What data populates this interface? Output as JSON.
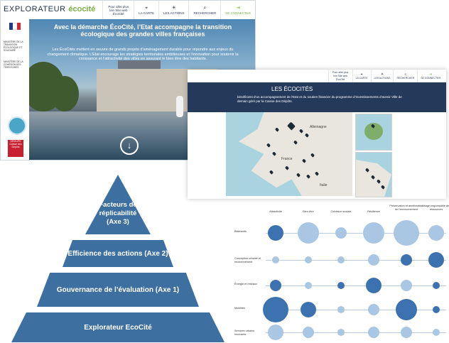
{
  "home": {
    "logo_text": "EXPLORATEUR",
    "logo_accent": "écocité",
    "nav": {
      "site_link": "Pour aller plus loin Site web ÉcoCité",
      "items": [
        {
          "label": "LA CARTE",
          "icon": "map-pin-icon"
        },
        {
          "label": "LES ACTIONS",
          "icon": "lightbulb-icon"
        },
        {
          "label": "RECHERCHER",
          "icon": "search-icon"
        },
        {
          "label": "SE CONNECTER",
          "icon": "login-icon"
        }
      ]
    },
    "ministry_1": "MINISTÈRE DE LA TRANSITION ÉCOLOGIQUE ET SOLIDAIRE",
    "ministry_2": "MINISTÈRE DE LA COHÉSION DES TERRITOIRES",
    "partner_logo": "GROUPE Caisse des Dépôts",
    "hero_title": "Avec la démarche ÉcoCité, l’Etat accompagne la transition écologique des grandes villes françaises",
    "hero_text": "Les ÉcoCités mettent en oeuvre de grands projets d’aménagement durable pour répondre aux enjeux du changement climatique. L’Etat encourage les stratégies territoriales ambitieuses et l’innovation pour soutenir la croissance et l’attractivité des villes en assurant le bien être des habitants.",
    "down_icon": "arrow-down-icon"
  },
  "map_page": {
    "nav": {
      "site_link": "Pour aller plus loin Site web ÉcoCité",
      "items": [
        {
          "label": "LA CARTE",
          "icon": "map-pin-icon"
        },
        {
          "label": "LES ACTIONS",
          "icon": "lightbulb-icon"
        },
        {
          "label": "RECHERCHER",
          "icon": "search-icon"
        },
        {
          "label": "SE CONNECTER",
          "icon": "login-icon"
        }
      ]
    },
    "title": "LES ÉCOCITÉS",
    "text": "bénéficient d’un accompagnement de l’Etat et du soutien financier du programme d’Investissements d’avenir Ville de demain géré par la Caisse des Dépôts.",
    "map_labels": [
      "Allemagne",
      "France",
      "Italie"
    ]
  },
  "pyramid": {
    "levels": [
      "Facteurs de réplicabilité (Axe 3)",
      "Efficience des actions (Axe 2)",
      "Gouvernance de l’évaluation (Axe 1)",
      "Explorateur EcoCité"
    ]
  },
  "matrix": {
    "columns": [
      "Attractivité",
      "Bien-être",
      "Cohésion sociale",
      "Résilience",
      "Préservation et amélioration de l’environnement",
      "Usage responsable des ressources"
    ],
    "rows": [
      "Bâtiments",
      "Conception urbaine et environnement",
      "Énergie et réseaux",
      "Mobilités",
      "Services urbains innovants"
    ],
    "sizes": [
      [
        3,
        4,
        2,
        4,
        5,
        3
      ],
      [
        1,
        1,
        1,
        2,
        2,
        3
      ],
      [
        2,
        1,
        1,
        3,
        2,
        1
      ],
      [
        5,
        3,
        1,
        2,
        4,
        1
      ],
      [
        3,
        2,
        1,
        2,
        2,
        1
      ]
    ],
    "shades": [
      [
        0,
        1,
        1,
        1,
        1,
        1
      ],
      [
        1,
        1,
        1,
        1,
        0,
        0
      ],
      [
        0,
        1,
        0,
        0,
        1,
        0
      ],
      [
        0,
        0,
        1,
        1,
        0,
        0
      ],
      [
        1,
        1,
        1,
        1,
        1,
        1
      ]
    ],
    "colors": {
      "dark": "#3d72b0",
      "light": "#a9c6e3",
      "pyramid": "#3d6fa1",
      "banner": "#25395a",
      "accent": "#7cb342"
    }
  }
}
